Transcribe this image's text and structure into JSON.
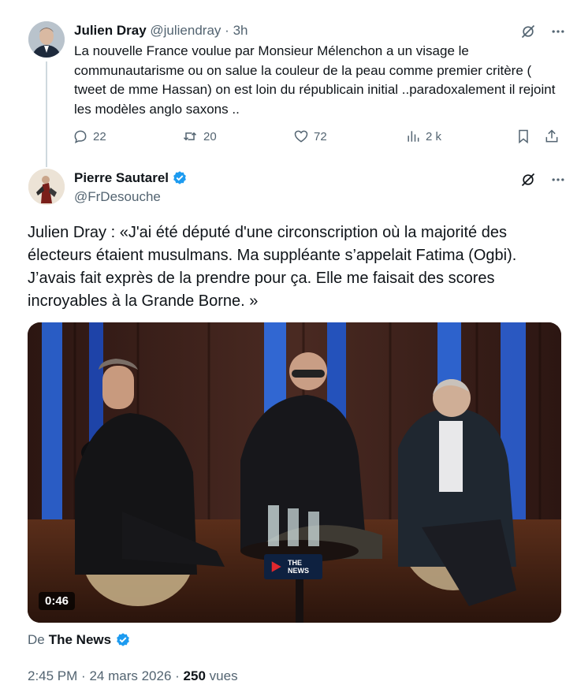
{
  "reply": {
    "author_name": "Julien Dray",
    "author_handle": "@juliendray",
    "separator": "·",
    "time": "3h",
    "text": "La nouvelle France voulue par Monsieur Mélenchon a un visage le communautarisme ou on salue la couleur de la peau comme premier critère ( tweet de mme Hassan) on est loin du républicain initial ..paradoxalement il rejoint les modèles anglo saxons ..",
    "stats": {
      "replies": "22",
      "reposts": "20",
      "likes": "72",
      "views": "2 k"
    }
  },
  "quoted": {
    "author_name": "Pierre Sautarel",
    "author_handle": "@FrDesouche",
    "text": "Julien Dray : «J'ai été député d'une circonscription où la majorité des électeurs étaient musulmans. Ma suppléante s’appelait Fatima (Ogbi). J’avais fait exprès de la prendre pour ça. Elle me faisait des scores incroyables à la Grande Borne. »",
    "video": {
      "duration": "0:46",
      "logo_line1": "THE",
      "logo_line2": "NEWS"
    },
    "source_prefix": "De",
    "source_name": "The News",
    "time": "2:45 PM",
    "date": "24 mars 2026",
    "meta_separator": "·",
    "views_count": "250",
    "views_label": "vues"
  },
  "icons": {
    "grok": "grok-icon",
    "more": "more-icon",
    "reply": "reply-icon",
    "repost": "repost-icon",
    "like": "like-icon",
    "views": "views-icon",
    "bookmark": "bookmark-icon",
    "share": "share-icon",
    "verified": "verified-badge-icon"
  },
  "colors": {
    "text": "#0f1419",
    "secondary": "#536471",
    "verified": "#1d9bf0",
    "thread_line": "#cfd9de"
  }
}
